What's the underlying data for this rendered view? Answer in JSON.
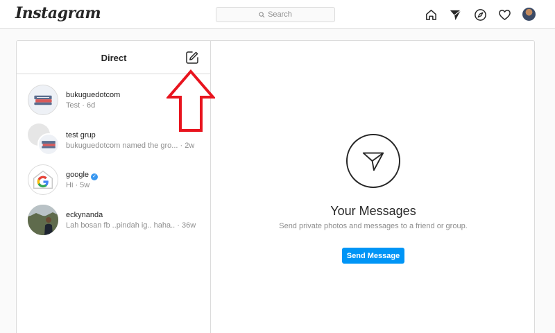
{
  "app": {
    "logo_text": "Instagram"
  },
  "search": {
    "placeholder": "Search"
  },
  "nav": {
    "icons": [
      "home-icon",
      "direct-icon",
      "explore-icon",
      "activity-heart-icon",
      "profile-avatar"
    ]
  },
  "direct": {
    "title": "Direct",
    "threads": [
      {
        "name": "bukuguedotcom",
        "preview": "Test · 6d",
        "verified": false
      },
      {
        "name": "test grup",
        "preview": "bukuguedotcom named the gro... · 2w",
        "verified": false
      },
      {
        "name": "google",
        "preview": "Hi · 5w",
        "verified": true,
        "verified_glyph": "✓"
      },
      {
        "name": "eckynanda",
        "preview": "Lah bosan fb ..pindah ig.. haha.. · 36w",
        "verified": false
      }
    ]
  },
  "empty_state": {
    "title": "Your Messages",
    "subtitle": "Send private photos and messages to a friend or group.",
    "button_label": "Send Message"
  },
  "colors": {
    "accent": "#0095f6",
    "border": "#dbdbdb",
    "secondary_text": "#8e8e8e",
    "annotation_red": "#e8141e"
  }
}
